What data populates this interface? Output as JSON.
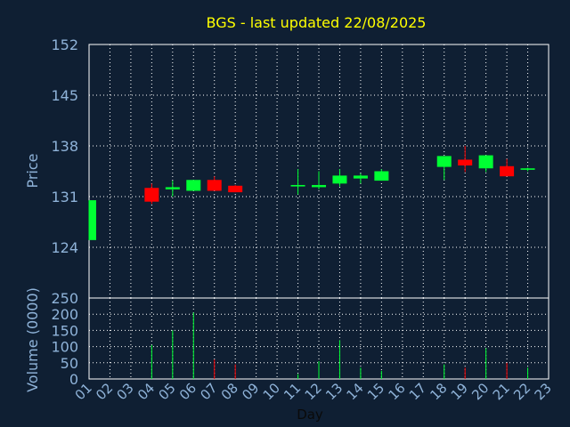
{
  "title": "BGS - last updated 22/08/2025",
  "colors": {
    "background": "#0f1f33",
    "plot_border": "#ffffff",
    "grid": "#ffffff",
    "title": "#ffff00",
    "axis_text": "#8fb3d9",
    "up": "#00ff33",
    "down": "#ff0000"
  },
  "chart_data": [
    {
      "type": "candlestick",
      "ylabel": "Price",
      "ylim": [
        117,
        152
      ],
      "yticks": [
        "152",
        "145",
        "138",
        "131",
        "124"
      ],
      "ytick_values": [
        152,
        145,
        138,
        131,
        124
      ],
      "xlim": [
        1,
        23
      ],
      "grid": true,
      "candles": [
        {
          "day": 1,
          "open": 125.0,
          "high": 130.5,
          "low": 125.0,
          "close": 130.5
        },
        {
          "day": 4,
          "open": 132.2,
          "high": 132.8,
          "low": 130.0,
          "close": 130.3
        },
        {
          "day": 5,
          "open": 132.0,
          "high": 133.2,
          "low": 131.0,
          "close": 132.3
        },
        {
          "day": 6,
          "open": 131.8,
          "high": 133.3,
          "low": 131.8,
          "close": 133.3
        },
        {
          "day": 7,
          "open": 133.3,
          "high": 133.8,
          "low": 131.8,
          "close": 131.8
        },
        {
          "day": 8,
          "open": 132.5,
          "high": 132.6,
          "low": 131.6,
          "close": 131.6
        },
        {
          "day": 11,
          "open": 132.4,
          "high": 134.8,
          "low": 131.3,
          "close": 132.6
        },
        {
          "day": 12,
          "open": 132.3,
          "high": 134.5,
          "low": 132.0,
          "close": 132.6
        },
        {
          "day": 13,
          "open": 132.8,
          "high": 134.8,
          "low": 132.4,
          "close": 133.9
        },
        {
          "day": 14,
          "open": 133.5,
          "high": 134.2,
          "low": 132.8,
          "close": 133.9
        },
        {
          "day": 15,
          "open": 133.2,
          "high": 134.8,
          "low": 133.2,
          "close": 134.5
        },
        {
          "day": 18,
          "open": 135.1,
          "high": 136.6,
          "low": 133.3,
          "close": 136.6
        },
        {
          "day": 19,
          "open": 136.1,
          "high": 138.0,
          "low": 134.4,
          "close": 135.3
        },
        {
          "day": 20,
          "open": 134.9,
          "high": 136.7,
          "low": 134.4,
          "close": 136.7
        },
        {
          "day": 21,
          "open": 135.2,
          "high": 136.2,
          "low": 133.8,
          "close": 133.8
        },
        {
          "day": 22,
          "open": 134.7,
          "high": 135.0,
          "low": 134.5,
          "close": 134.9
        }
      ]
    },
    {
      "type": "bar",
      "ylabel": "Volume (0000)",
      "xlabel": "Day",
      "ylim": [
        0,
        250
      ],
      "yticks": [
        "250",
        "200",
        "150",
        "100",
        "50",
        "0"
      ],
      "ytick_values": [
        250,
        200,
        150,
        100,
        50,
        0
      ],
      "xlim": [
        1,
        23
      ],
      "xticks": [
        "01",
        "02",
        "03",
        "04",
        "05",
        "06",
        "07",
        "08",
        "09",
        "10",
        "11",
        "12",
        "13",
        "14",
        "15",
        "16",
        "17",
        "18",
        "19",
        "20",
        "21",
        "22",
        "23"
      ],
      "bars": [
        {
          "day": 4,
          "value": 105,
          "direction": "up"
        },
        {
          "day": 5,
          "value": 150,
          "direction": "up"
        },
        {
          "day": 6,
          "value": 205,
          "direction": "up"
        },
        {
          "day": 7,
          "value": 60,
          "direction": "down"
        },
        {
          "day": 8,
          "value": 45,
          "direction": "down"
        },
        {
          "day": 11,
          "value": 15,
          "direction": "up"
        },
        {
          "day": 12,
          "value": 55,
          "direction": "up"
        },
        {
          "day": 13,
          "value": 120,
          "direction": "up"
        },
        {
          "day": 14,
          "value": 35,
          "direction": "up"
        },
        {
          "day": 15,
          "value": 25,
          "direction": "up"
        },
        {
          "day": 18,
          "value": 45,
          "direction": "up"
        },
        {
          "day": 19,
          "value": 35,
          "direction": "down"
        },
        {
          "day": 20,
          "value": 95,
          "direction": "up"
        },
        {
          "day": 21,
          "value": 50,
          "direction": "down"
        },
        {
          "day": 22,
          "value": 35,
          "direction": "up"
        }
      ]
    }
  ]
}
